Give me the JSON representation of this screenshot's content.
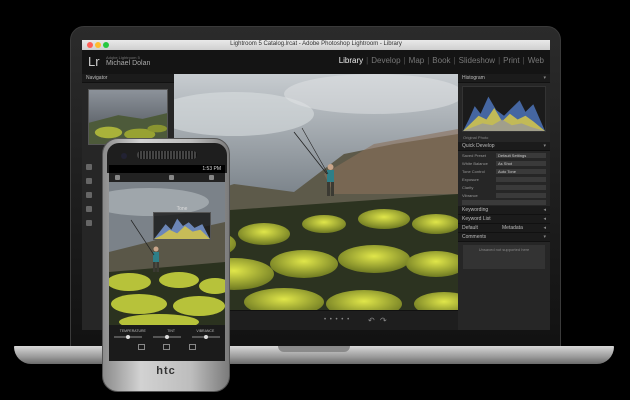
{
  "window": {
    "title": "Lightroom 5 Catalog.lrcat - Adobe Photoshop Lightroom - Library"
  },
  "identity": {
    "logo": "Lr",
    "subtitle": "Adobe Lightroom 5",
    "user": "Michael Dolan"
  },
  "modules": [
    "Library",
    "Develop",
    "Map",
    "Book",
    "Slideshow",
    "Print",
    "Web"
  ],
  "active_module": "Library",
  "left_panel": {
    "navigator_title": "Navigator"
  },
  "right_panel": {
    "histogram_title": "Histogram",
    "original_photo": "Original Photo",
    "quick_develop_title": "Quick Develop",
    "saved_preset_label": "Saved Preset",
    "saved_preset_value": "Default Settings",
    "white_balance_label": "White Balance",
    "white_balance_value": "As Shot",
    "tone_control_label": "Tone Control",
    "tone_control_value": "Auto Tone",
    "exposure_label": "Exposure",
    "clarity_label": "Clarity",
    "vibrance_label": "Vibrance",
    "keywording_title": "Keywording",
    "keyword_list_title": "Keyword List",
    "metadata_label": "Default",
    "metadata_title": "Metadata",
    "comments_title": "Comments",
    "comments_text": "Unsaved not supported here"
  },
  "phone": {
    "brand": "htc",
    "time": "1:53 PM",
    "histogram_label": "Tone",
    "control_labels": [
      "TEMPERATURE",
      "TINT",
      "VIBRANCE"
    ]
  },
  "colors": {
    "accent": "#eeeeee",
    "panel": "#262626",
    "background": "#000000"
  }
}
